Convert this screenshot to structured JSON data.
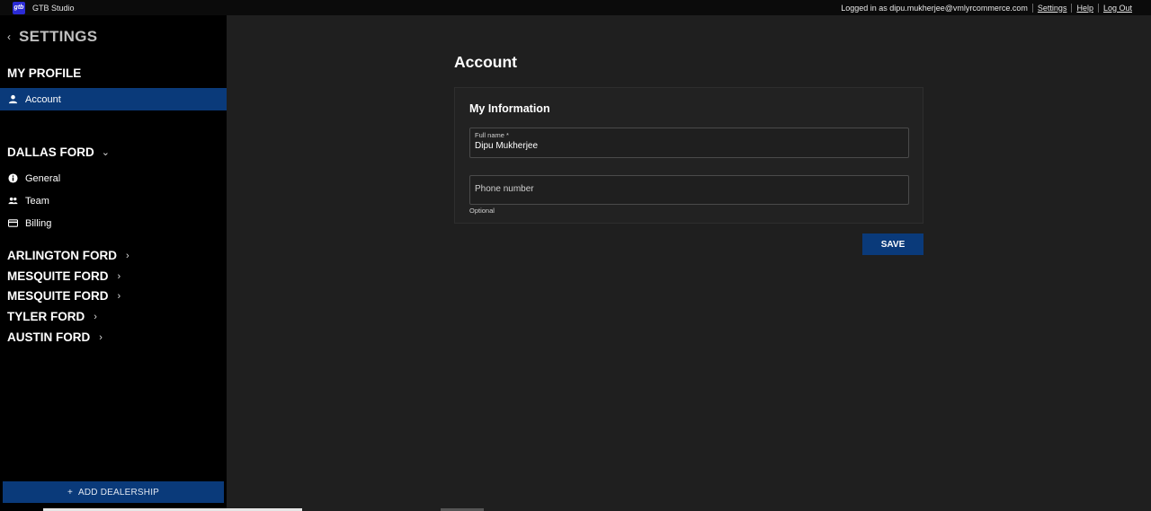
{
  "app": {
    "logo_text": "gtb",
    "title": "GTB Studio"
  },
  "topbar": {
    "logged_in": "Logged in as dipu.mukherjee@vmlyrcommerce.com",
    "links": [
      "Settings",
      "Help",
      "Log Out"
    ]
  },
  "sidebar": {
    "back_glyph": "‹",
    "title": "SETTINGS",
    "profile_section": "MY PROFILE",
    "profile_items": [
      {
        "label": "Account",
        "icon": "person-icon"
      }
    ],
    "current_dealer": "DALLAS FORD",
    "dealer_items": [
      {
        "label": "General",
        "icon": "info-icon"
      },
      {
        "label": "Team",
        "icon": "people-icon"
      },
      {
        "label": "Billing",
        "icon": "credit-card-icon"
      }
    ],
    "other_dealers": [
      "ARLINGTON FORD",
      "MESQUITE FORD",
      "MESQUITE FORD",
      "TYLER FORD",
      "AUSTIN FORD"
    ],
    "add_button": "ADD DEALERSHIP",
    "add_glyph": "+"
  },
  "main": {
    "title": "Account",
    "card_title": "My Information",
    "full_name_label": "Full name *",
    "full_name_value": "Dipu Mukherjee",
    "phone_placeholder": "Phone number",
    "phone_helper": "Optional",
    "save_label": "SAVE"
  },
  "colors": {
    "accent": "#0a3a7a",
    "sidebar_bg": "#000000",
    "main_bg": "#1f1f1f"
  }
}
